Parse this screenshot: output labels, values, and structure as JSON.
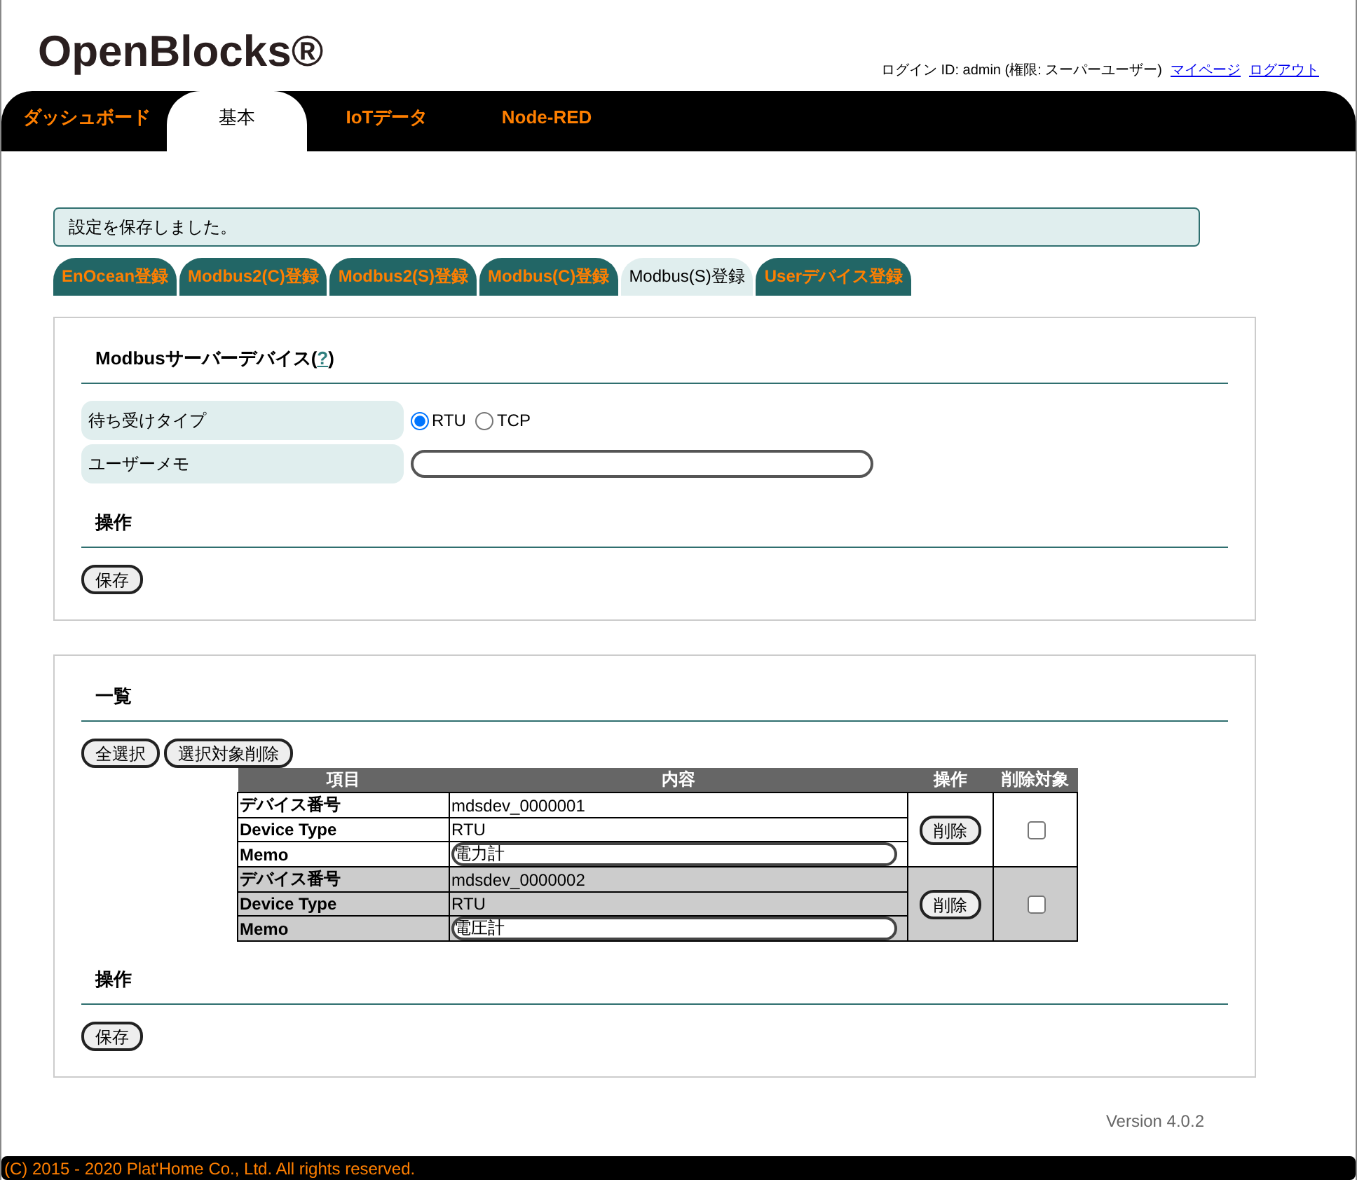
{
  "logo": "OpenBlocks®",
  "user_info": {
    "text": "ログイン ID: admin (権限: スーパーユーザー)",
    "links": [
      "マイページ",
      "ログアウト"
    ]
  },
  "nav_tabs": [
    {
      "label": "ダッシュボード",
      "selected": false
    },
    {
      "label": "基本",
      "selected": true
    },
    {
      "label": "IoTデータ",
      "selected": false
    },
    {
      "label": "Node-RED",
      "selected": false
    }
  ],
  "message": "設定を保存しました。",
  "sub_tabs": [
    {
      "label": "EnOcean登録",
      "selected": false
    },
    {
      "label": "Modbus2(C)登録",
      "selected": false
    },
    {
      "label": "Modbus2(S)登録",
      "selected": false
    },
    {
      "label": "Modbus(C)登録",
      "selected": false
    },
    {
      "label": "Modbus(S)登録",
      "selected": true
    },
    {
      "label": "Userデバイス登録",
      "selected": false
    }
  ],
  "server_panel": {
    "title": "Modbusサーバーデバイス(",
    "help": "?",
    "title_end": ")",
    "fields": [
      {
        "kind": "radio",
        "label": "待ち受けタイプ",
        "options": [
          {
            "label": "RTU",
            "selected": true
          },
          {
            "label": "TCP",
            "selected": false
          }
        ]
      },
      {
        "kind": "text",
        "label": "ユーザーメモ"
      }
    ],
    "ops_title": "操作",
    "save": "保存"
  },
  "list_panel": {
    "title": "一覧",
    "buttons": [
      "全選択",
      "選択対象削除"
    ],
    "columns": [
      "項目",
      "内容",
      "操作",
      "削除対象"
    ],
    "devices": [
      {
        "rows": [
          {
            "label": "デバイス番号",
            "value": "mdsdev_0000001",
            "kind": "text"
          },
          {
            "label": "Device Type",
            "value": "RTU",
            "kind": "text"
          },
          {
            "label": "Memo",
            "value": "電力計",
            "kind": "input"
          }
        ],
        "delete": "削除",
        "checked": false
      },
      {
        "rows": [
          {
            "label": "デバイス番号",
            "value": "mdsdev_0000002",
            "kind": "text"
          },
          {
            "label": "Device Type",
            "value": "RTU",
            "kind": "text"
          },
          {
            "label": "Memo",
            "value": "電圧計",
            "kind": "input"
          }
        ],
        "delete": "削除",
        "checked": false
      }
    ],
    "ops_title": "操作",
    "save": "保存"
  },
  "version": "Version 4.0.2",
  "footer": "(C) 2015 - 2020 Plat'Home Co., Ltd. All rights reserved."
}
